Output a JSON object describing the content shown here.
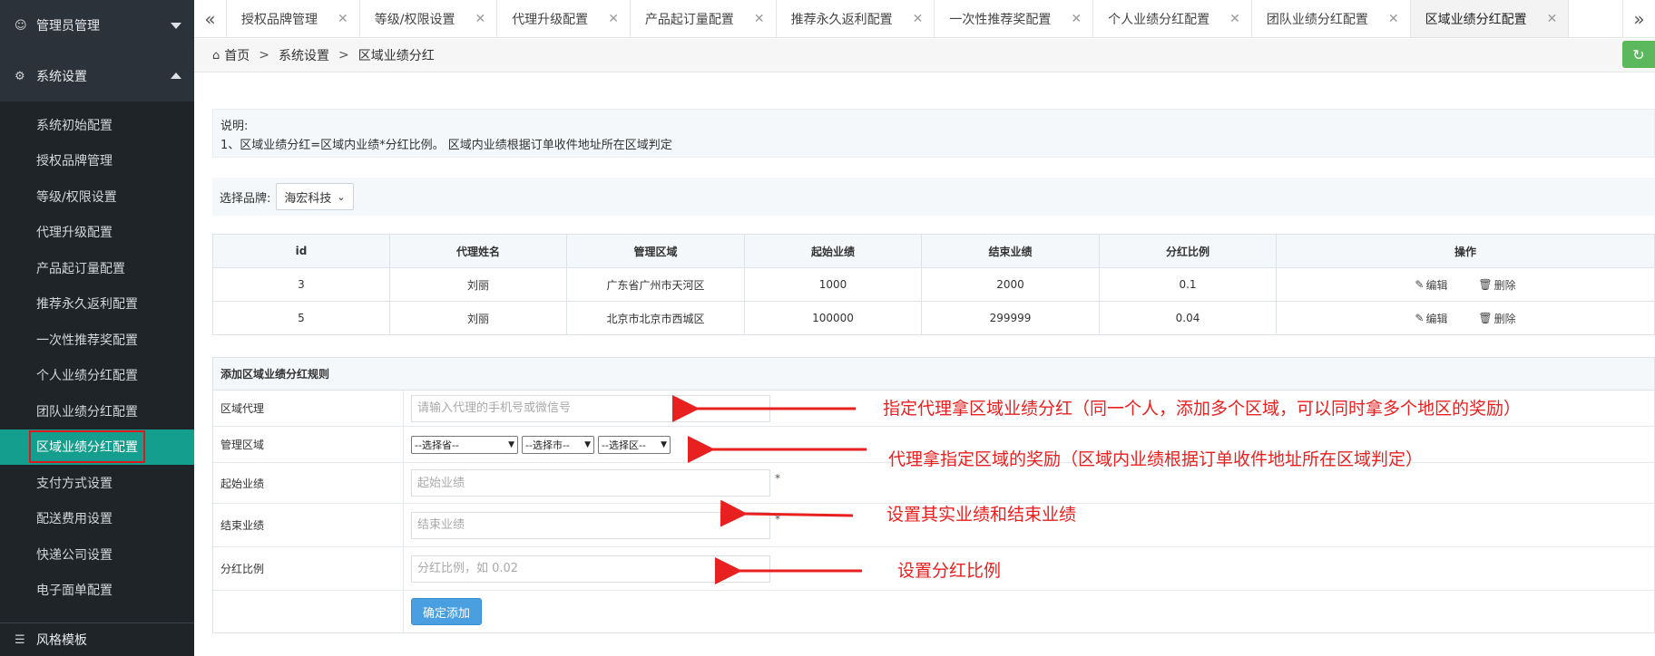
{
  "sidebar": {
    "groups": [
      {
        "label": "管理员管理"
      },
      {
        "label": "系统设置"
      },
      {
        "label": "风格模板"
      }
    ],
    "items": [
      {
        "label": "系统初始配置"
      },
      {
        "label": "授权品牌管理"
      },
      {
        "label": "等级/权限设置"
      },
      {
        "label": "代理升级配置"
      },
      {
        "label": "产品起订量配置"
      },
      {
        "label": "推荐永久返利配置"
      },
      {
        "label": "一次性推荐奖配置"
      },
      {
        "label": "个人业绩分红配置"
      },
      {
        "label": "团队业绩分红配置"
      },
      {
        "label": "区域业绩分红配置"
      },
      {
        "label": "支付方式设置"
      },
      {
        "label": "配送费用设置"
      },
      {
        "label": "快递公司设置"
      },
      {
        "label": "电子面单配置"
      }
    ]
  },
  "tabs": [
    {
      "label": "授权品牌管理"
    },
    {
      "label": "等级/权限设置"
    },
    {
      "label": "代理升级配置"
    },
    {
      "label": "产品起订量配置"
    },
    {
      "label": "推荐永久返利配置"
    },
    {
      "label": "一次性推荐奖配置"
    },
    {
      "label": "个人业绩分红配置"
    },
    {
      "label": "团队业绩分红配置"
    },
    {
      "label": "区域业绩分红配置"
    }
  ],
  "breadcrumb": {
    "home": "首页",
    "sep": ">",
    "level1": "系统设置",
    "level2": "区域业绩分红"
  },
  "note": {
    "title": "说明:",
    "line1": "1、区域业绩分红=区域内业绩*分红比例。 区域内业绩根据订单收件地址所在区域判定"
  },
  "brand": {
    "label": "选择品牌:",
    "value": "海宏科技"
  },
  "table": {
    "headers": [
      "id",
      "代理姓名",
      "管理区域",
      "起始业绩",
      "结束业绩",
      "分红比例",
      "操作"
    ],
    "rows": [
      [
        "3",
        "刘丽",
        "广东省广州市天河区",
        "1000",
        "2000",
        "0.1"
      ],
      [
        "5",
        "刘丽",
        "北京市北京市西城区",
        "100000",
        "299999",
        "0.04"
      ]
    ],
    "edit": "编辑",
    "delete": "删除"
  },
  "form": {
    "title": "添加区域业绩分红规则",
    "agent_label": "区域代理",
    "agent_placeholder": "请输入代理的手机号或微信号",
    "region_label": "管理区域",
    "province": "--选择省--",
    "city": "--选择市--",
    "district": "--选择区--",
    "start_label": "起始业绩",
    "start_placeholder": "起始业绩",
    "end_label": "结束业绩",
    "end_placeholder": "结束业绩",
    "ratio_label": "分红比例",
    "ratio_placeholder": "分红比例，如 0.02",
    "required": "*",
    "submit": "确定添加"
  },
  "annotations": {
    "a1": "指定代理拿区域业绩分红（同一个人，添加多个区域，可以同时拿多个地区的奖励）",
    "a2": "代理拿指定区域的奖励（区域内业绩根据订单收件地址所在区域判定）",
    "a3": "设置其实业绩和结束业绩",
    "a4": "设置分红比例"
  },
  "colors": {
    "sidebar_bg": "#2b3239",
    "active_item": "#139e8d",
    "annotation": "#e8201f",
    "button": "#4a9fe0",
    "refresh": "#5cb85c"
  }
}
